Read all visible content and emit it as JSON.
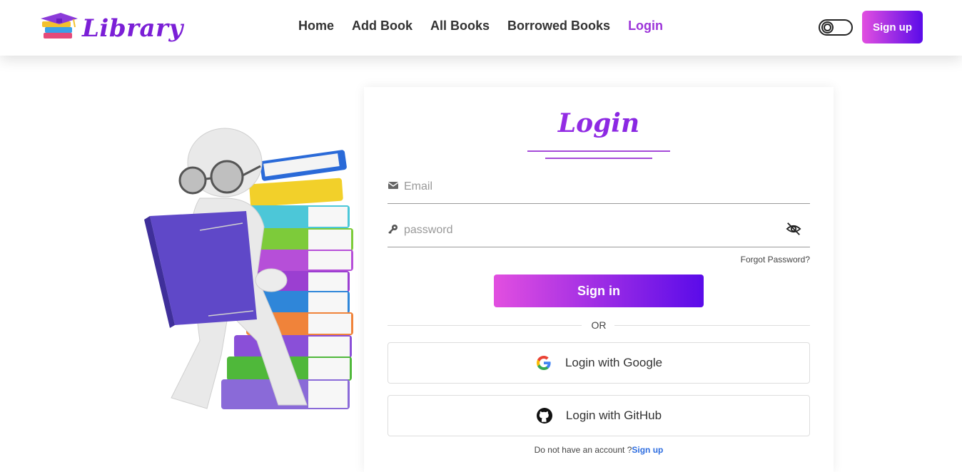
{
  "nav": {
    "logo_text": "Library",
    "links": [
      "Home",
      "Add Book",
      "All Books",
      "Borrowed Books",
      "Login"
    ],
    "active_link": "Login",
    "signup_label": "Sign up",
    "toggle_icon": "dark-mode-toggle"
  },
  "login": {
    "title": "Login",
    "email_placeholder": "Email",
    "password_placeholder": "password",
    "forgot_label": "Forgot Password?",
    "signin_label": "Sign in",
    "or_label": "OR",
    "google_label": "Login with Google",
    "github_label": "Login with GitHub",
    "footer_text": "Do not have an account ?",
    "footer_link": "Sign up"
  },
  "colors": {
    "accent": "#9c34d9",
    "gradient_start": "#e24fe0",
    "gradient_end": "#5a0be9",
    "link_blue": "#2f6ee0"
  }
}
